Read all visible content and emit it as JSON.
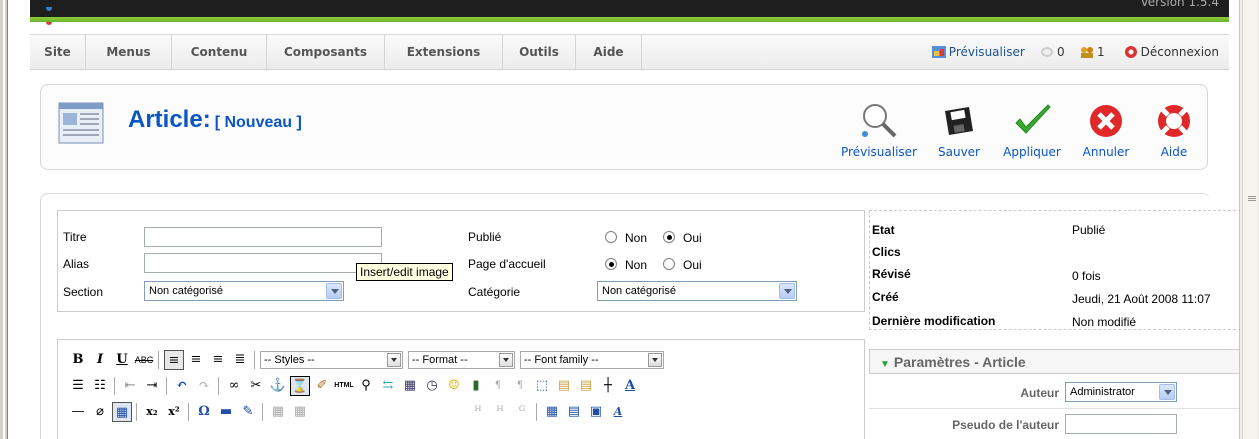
{
  "header": {
    "version": "Version 1.5.4"
  },
  "menu": {
    "items": [
      "Site",
      "Menus",
      "Contenu",
      "Composants",
      "Extensions",
      "Outils",
      "Aide"
    ],
    "preview_label": "Prévisualiser",
    "messages_count": "0",
    "users_count": "1",
    "logout_label": "Déconnexion"
  },
  "title": {
    "main": "Article:",
    "sub": "[ Nouveau ]"
  },
  "toolbar": {
    "preview": "Prévisualiser",
    "save": "Sauver",
    "apply": "Appliquer",
    "cancel": "Annuler",
    "help": "Aide"
  },
  "form": {
    "title_label": "Titre",
    "alias_label": "Alias",
    "section_label": "Section",
    "section_value": "Non catégorisé",
    "published_label": "Publié",
    "frontpage_label": "Page d'accueil",
    "category_label": "Catégorie",
    "category_value": "Non catégorisé",
    "no_label": "Non",
    "yes_label": "Oui"
  },
  "status": {
    "etat_label": "Etat",
    "etat_value": "Publié",
    "clics_label": "Clics",
    "revise_label": "Révisé",
    "revise_value": "0 fois",
    "cree_label": "Créé",
    "cree_value": "Jeudi, 21 Août 2008 11:07",
    "modif_label": "Dernière modification",
    "modif_value": "Non modifié"
  },
  "editor": {
    "styles": "-- Styles --",
    "format": "-- Format --",
    "fontfamily": "-- Font family --",
    "tooltip": "Insert/edit image"
  },
  "params": {
    "header": "Paramètres - Article",
    "author_label": "Auteur",
    "author_value": "Administrator",
    "alias_label": "Pseudo de l'auteur"
  }
}
